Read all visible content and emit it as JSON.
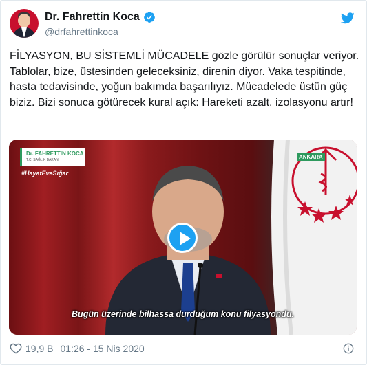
{
  "author": {
    "display_name": "Dr. Fahrettin Koca",
    "handle": "@drfahrettinkoca",
    "verified": true
  },
  "icons": {
    "verified": "verified-badge-icon",
    "platform": "twitter-bird-icon",
    "like": "heart-icon",
    "info": "info-icon",
    "play": "play-icon"
  },
  "tweet": {
    "text": "FİLYASYON, BU SİSTEMLİ MÜCADELE gözle görülür sonuçlar veriyor. Tablolar, bize, üstesinden geleceksiniz, direnin diyor. Vaka tespitinde, hasta tedavisinde, yoğun bakımda başarılıyız. Mücadelede üstün güç biziz. Bizi sonuca götürecek kural açık: Hareketi azalt, izolasyonu artır!"
  },
  "video": {
    "logo_title": "Dr. FAHRETTİN KOCA",
    "logo_subtitle": "T.C. SAĞLIK BAKANI",
    "hashtag": "#HayatEveSığar",
    "location_tag": "ANKARA",
    "caption": "Bugün üzerinde bilhassa durduğum konu filyasyondu."
  },
  "footer": {
    "like_count": "19,9 B",
    "timestamp": "01:26 - 15 Nis 2020"
  },
  "colors": {
    "accent": "#1da1f2",
    "text": "#14171a",
    "secondary_text": "#657786",
    "border": "#e1e8ed"
  }
}
